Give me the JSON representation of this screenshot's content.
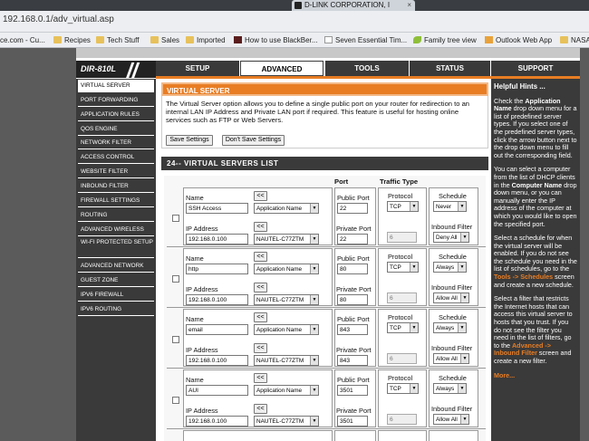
{
  "browser": {
    "tab_title": "D-LINK CORPORATION, I",
    "url": "192.168.0.1/adv_virtual.asp",
    "bookmarks": [
      {
        "label": "ce.com - Cu...",
        "icon": "web-icon"
      },
      {
        "label": "Recipes",
        "icon": "folder-icon"
      },
      {
        "label": "Tech Stuff",
        "icon": "folder-icon"
      },
      {
        "label": "Sales",
        "icon": "folder-icon"
      },
      {
        "label": "Imported",
        "icon": "folder-icon"
      },
      {
        "label": "How to use BlackBer...",
        "icon": "web-icon"
      },
      {
        "label": "Seven Essential Tim...",
        "icon": "document-icon"
      },
      {
        "label": "Family tree view",
        "icon": "leaf-icon"
      },
      {
        "label": "Outlook Web App",
        "icon": "web-icon"
      },
      {
        "label": "NASA",
        "icon": "folder-icon"
      }
    ]
  },
  "router": {
    "model": "DIR-810L",
    "tabs": [
      "SETUP",
      "ADVANCED",
      "TOOLS",
      "STATUS",
      "SUPPORT"
    ],
    "active_tab": "ADVANCED"
  },
  "sidebar": {
    "items": [
      "VIRTUAL SERVER",
      "PORT FORWARDING",
      "APPLICATION RULES",
      "QOS ENGINE",
      "NETWORK FILTER",
      "ACCESS CONTROL",
      "WEBSITE FILTER",
      "INBOUND FILTER",
      "FIREWALL SETTINGS",
      "ROUTING",
      "ADVANCED WIRELESS",
      "WI-FI PROTECTED SETUP",
      "ADVANCED NETWORK",
      "GUEST ZONE",
      "IPV6 FIREWALL",
      "IPV6 ROUTING"
    ]
  },
  "virtual_server": {
    "heading": "VIRTUAL SERVER",
    "description": "The Virtual Server option allows you to define a single public port on your router for redirection to an internal LAN IP Address and Private LAN port if required. This feature is useful for hosting online services such as FTP or Web Servers.",
    "save_label": "Save Settings",
    "dont_save_label": "Don't Save Settings"
  },
  "list": {
    "heading": "24-- VIRTUAL SERVERS LIST",
    "col_port": "Port",
    "col_traffic": "Traffic Type",
    "labels": {
      "name": "Name",
      "ip": "IP Address",
      "public_port": "Public Port",
      "private_port": "Private Port",
      "protocol": "Protocol",
      "schedule": "Schedule",
      "inbound": "Inbound Filter",
      "copy_btn": "<<"
    },
    "rows": [
      {
        "name": "SSH Access",
        "app": "Application Name",
        "ip": "192.168.0.100",
        "computer": "NAUTEL-C77ZTM",
        "public_port": "22",
        "private_port": "22",
        "protocol": "TCP",
        "proto_num": "6",
        "schedule": "Never",
        "inbound": "Deny All"
      },
      {
        "name": "http",
        "app": "Application Name",
        "ip": "192.168.0.100",
        "computer": "NAUTEL-C77ZTM",
        "public_port": "80",
        "private_port": "80",
        "protocol": "TCP",
        "proto_num": "6",
        "schedule": "Always",
        "inbound": "Allow All"
      },
      {
        "name": "email",
        "app": "Application Name",
        "ip": "192.168.0.100",
        "computer": "NAUTEL-C77ZTM",
        "public_port": "843",
        "private_port": "843",
        "protocol": "TCP",
        "proto_num": "6",
        "schedule": "Always",
        "inbound": "Allow All"
      },
      {
        "name": "AUI",
        "app": "Application Name",
        "ip": "192.168.0.100",
        "computer": "NAUTEL-C77ZTM",
        "public_port": "3501",
        "private_port": "3501",
        "protocol": "TCP",
        "proto_num": "6",
        "schedule": "Always",
        "inbound": "Allow All"
      }
    ]
  },
  "help": {
    "title": "Helpful Hints ...",
    "p1_a": "Check the ",
    "p1_b": "Application Name",
    "p1_c": " drop down menu for a list of predefined server types. If you select one of the predefined server types, click the arrow button next to the drop down menu to fill out the corresponding field.",
    "p2_a": "You can select a computer from the list of DHCP clients in the ",
    "p2_b": "Computer Name",
    "p2_c": " drop down menu, or you can manually enter the IP address of the computer at which you would like to open the specified port.",
    "p3_a": "Select a schedule for when the virtual server will be enabled. If you do not see the schedule you need in the list of schedules, go to the ",
    "p3_b": "Tools -> Schedules",
    "p3_c": " screen and create a new schedule.",
    "p4_a": "Select a filter that restricts the Internet hosts that can access this virtual server to hosts that you trust. If you do not see the filter you need in the list of filters, go to the ",
    "p4_b": "Advanced -> Inbound Filter",
    "p4_c": " screen and create a new filter.",
    "more": "More..."
  },
  "colors": {
    "accent": "#e87d24",
    "dark": "#3a3a3a"
  }
}
